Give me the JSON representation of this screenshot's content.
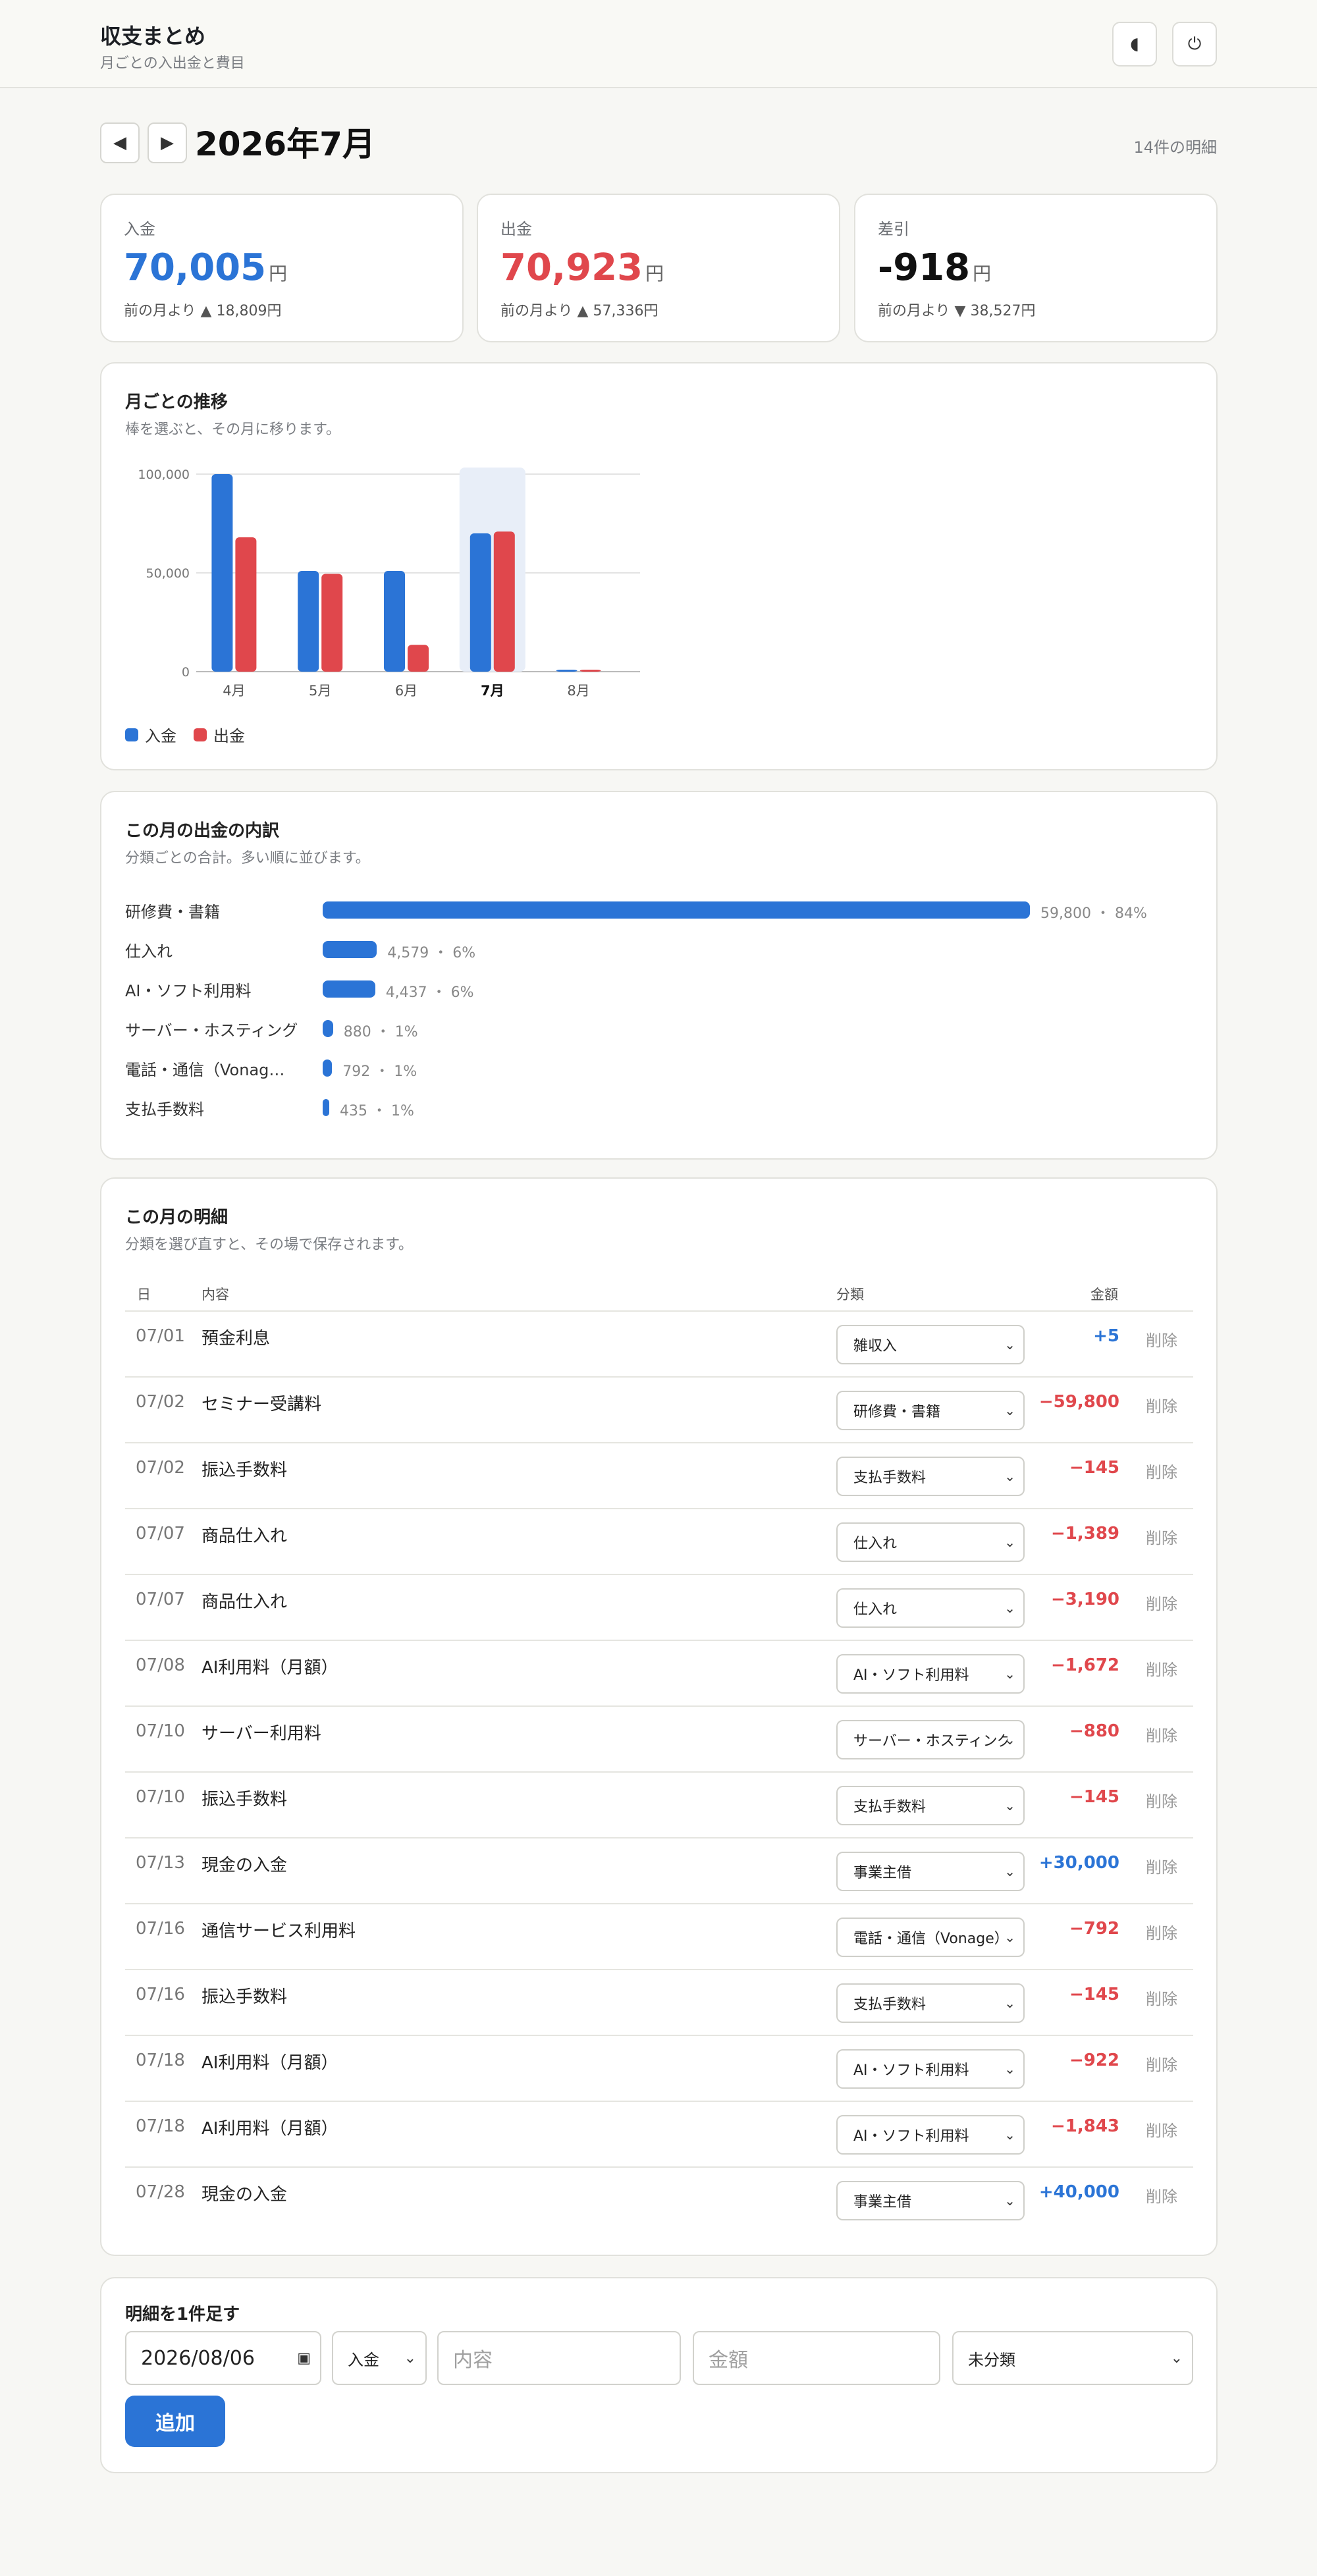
{
  "header": {
    "title": "収支まとめ",
    "subtitle": "月ごとの入出金と費目",
    "theme_icon": "◖",
    "power_icon": "⏻"
  },
  "month_nav": {
    "prev_icon": "◀",
    "next_icon": "▶",
    "current_month": "2026年7月",
    "entry_count": "14件の明細"
  },
  "summary": {
    "income": {
      "label": "入金",
      "value": "70,005",
      "unit": "円",
      "delta": "前の月より ▲ 18,809円"
    },
    "expense": {
      "label": "出金",
      "value": "70,923",
      "unit": "円",
      "delta": "前の月より ▲ 57,336円"
    },
    "balance": {
      "label": "差引",
      "value": "-918",
      "unit": "円",
      "delta": "前の月より ▼ 38,527円"
    }
  },
  "trend": {
    "title": "月ごとの推移",
    "subtitle": "棒を選ぶと、その月に移ります。"
  },
  "chart_data": {
    "type": "bar",
    "categories": [
      "4月",
      "5月",
      "6月",
      "7月",
      "8月"
    ],
    "selected_category": "7月",
    "series": [
      {
        "name": "入金",
        "color": "#2b74d6",
        "values": [
          100000,
          51000,
          51000,
          70005,
          1000
        ]
      },
      {
        "name": "出金",
        "color": "#e0474c",
        "values": [
          68000,
          49500,
          13587,
          70923,
          1000
        ]
      }
    ],
    "yticks": [
      "0",
      "50,000",
      "100,000"
    ],
    "ylim": [
      0,
      100000
    ],
    "grid": true,
    "legend": "bottom-left"
  },
  "breakdown": {
    "title": "この月の出金の内訳",
    "subtitle": "分類ごとの合計。多い順に並びます。",
    "items": [
      {
        "label": "研修費・書籍",
        "amount": 59800,
        "text": "59,800 ・ 84%"
      },
      {
        "label": "仕入れ",
        "amount": 4579,
        "text": "4,579 ・ 6%"
      },
      {
        "label": "AI・ソフト利用料",
        "amount": 4437,
        "text": "4,437 ・ 6%"
      },
      {
        "label": "サーバー・ホスティング",
        "amount": 880,
        "text": "880 ・ 1%"
      },
      {
        "label": "電話・通信（Vonag…",
        "amount": 792,
        "text": "792 ・ 1%"
      },
      {
        "label": "支払手数料",
        "amount": 435,
        "text": "435 ・ 1%"
      }
    ]
  },
  "ledger": {
    "title": "この月の明細",
    "subtitle": "分類を選び直すと、その場で保存されます。",
    "headers": {
      "date": "日",
      "desc": "内容",
      "category": "分類",
      "amount": "金額"
    },
    "delete_label": "削除",
    "rows": [
      {
        "date": "07/01",
        "desc": "預金利息",
        "category": "雑収入",
        "amount": "+5",
        "type": "in"
      },
      {
        "date": "07/02",
        "desc": "セミナー受講料",
        "category": "研修費・書籍",
        "amount": "−59,800",
        "type": "out"
      },
      {
        "date": "07/02",
        "desc": "振込手数料",
        "category": "支払手数料",
        "amount": "−145",
        "type": "out"
      },
      {
        "date": "07/07",
        "desc": "商品仕入れ",
        "category": "仕入れ",
        "amount": "−1,389",
        "type": "out"
      },
      {
        "date": "07/07",
        "desc": "商品仕入れ",
        "category": "仕入れ",
        "amount": "−3,190",
        "type": "out"
      },
      {
        "date": "07/08",
        "desc": "AI利用料（月額）",
        "category": "AI・ソフト利用料",
        "amount": "−1,672",
        "type": "out"
      },
      {
        "date": "07/10",
        "desc": "サーバー利用料",
        "category": "サーバー・ホスティング",
        "amount": "−880",
        "type": "out"
      },
      {
        "date": "07/10",
        "desc": "振込手数料",
        "category": "支払手数料",
        "amount": "−145",
        "type": "out"
      },
      {
        "date": "07/13",
        "desc": "現金の入金",
        "category": "事業主借",
        "amount": "+30,000",
        "type": "in"
      },
      {
        "date": "07/16",
        "desc": "通信サービス利用料",
        "category": "電話・通信（Vonage）",
        "amount": "−792",
        "type": "out"
      },
      {
        "date": "07/16",
        "desc": "振込手数料",
        "category": "支払手数料",
        "amount": "−145",
        "type": "out"
      },
      {
        "date": "07/18",
        "desc": "AI利用料（月額）",
        "category": "AI・ソフト利用料",
        "amount": "−922",
        "type": "out"
      },
      {
        "date": "07/18",
        "desc": "AI利用料（月額）",
        "category": "AI・ソフト利用料",
        "amount": "−1,843",
        "type": "out"
      },
      {
        "date": "07/28",
        "desc": "現金の入金",
        "category": "事業主借",
        "amount": "+40,000",
        "type": "in"
      }
    ]
  },
  "add_form": {
    "title": "明細を1件足す",
    "date_value": "2026/08/06",
    "calendar_icon": "▣",
    "type_value": "入金",
    "desc_placeholder": "内容",
    "amount_placeholder": "金額",
    "category_value": "未分類",
    "submit_label": "追加"
  }
}
